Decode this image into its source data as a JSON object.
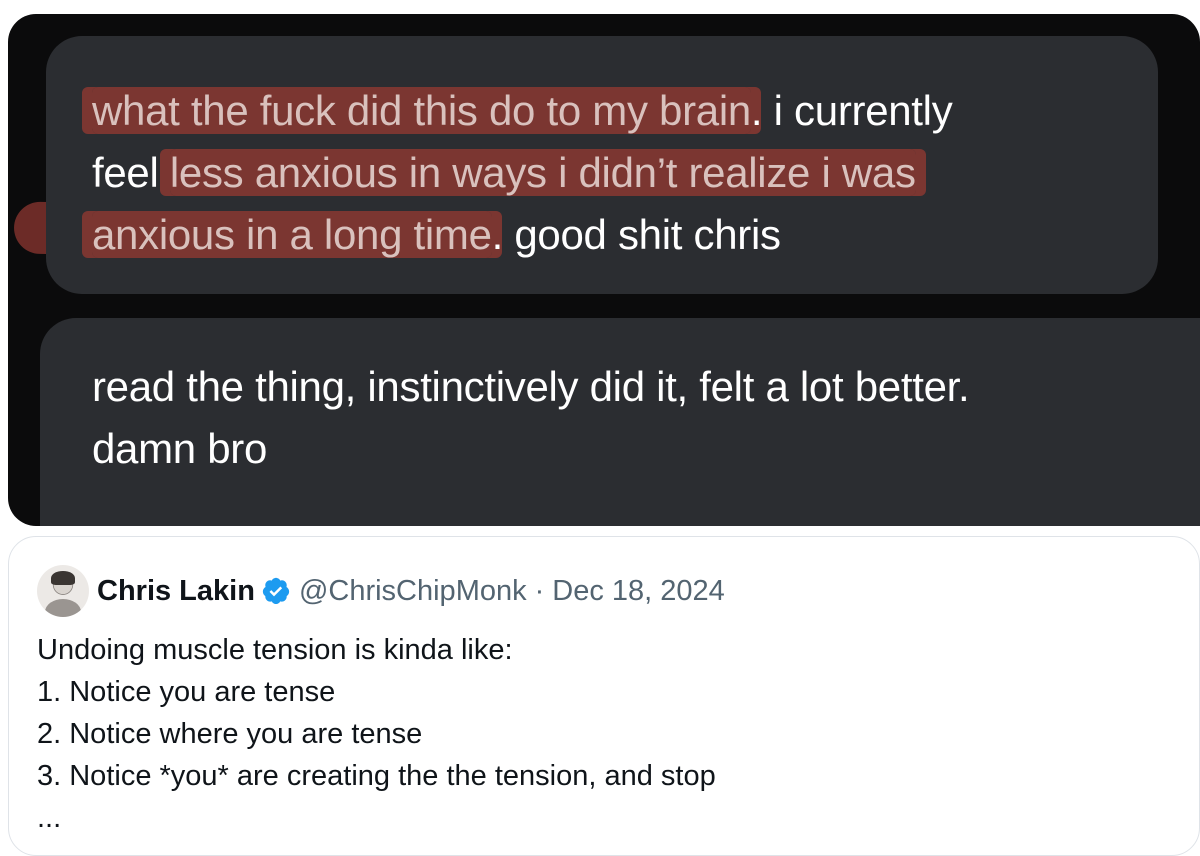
{
  "messages": [
    {
      "highlighted_segments": [
        "what the fuck did this do to my brain",
        "less anxious in ways i didn’t realize i was",
        "anxious in a long time"
      ],
      "line1_hl": "what the fuck did this do to my brain",
      "line1_rest": ". i currently",
      "line2_pre": "feel ",
      "line2_hl": "less anxious in ways i didn’t realize i was",
      "line3_hl": "anxious in a long time",
      "line3_rest": ". good shit chris",
      "highlight_color": "#923832"
    },
    {
      "line1": "read the thing, instinctively did it, felt a lot better.",
      "line2": "damn bro"
    }
  ],
  "tweet": {
    "author_name": "Chris Lakin",
    "handle": "@ChrisChipMonk",
    "separator": "·",
    "date": "Dec 18, 2024",
    "verified_icon": "verified-badge-icon",
    "verified_color": "#1d9bf0",
    "lines": [
      "Undoing muscle tension is kinda like:",
      "1. Notice you are tense",
      "2. Notice where you are tense",
      "3. Notice *you* are creating the the tension, and stop",
      "..."
    ]
  },
  "colors": {
    "panel_bg": "#0b0b0c",
    "bubble_bg": "#2b2d31",
    "text_primary": "#0f1419",
    "text_secondary": "#536471"
  }
}
